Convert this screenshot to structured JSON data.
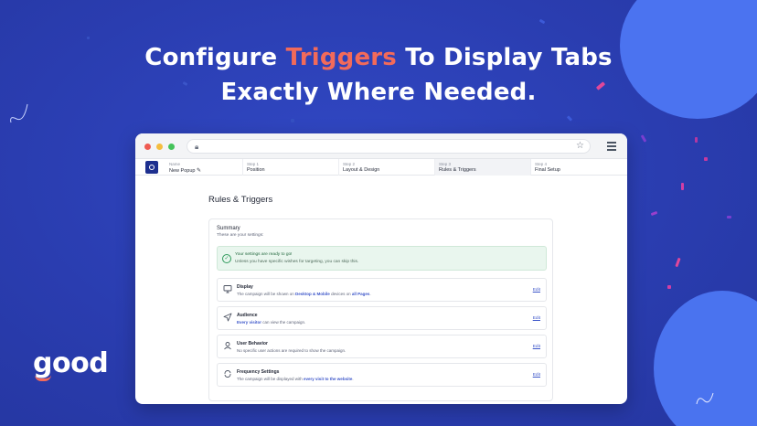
{
  "headline": {
    "line1_pre": "Configure ",
    "line1_accent": "Triggers",
    "line1_post": " To Display Tabs",
    "line2": "Exactly Where Needed."
  },
  "brand": "good",
  "colors": {
    "background": "#2a3fb0",
    "accent": "#f26a5a",
    "link": "#3b55c9",
    "success": "#2f9a5b"
  },
  "browser": {
    "lock_icon": "lock-icon",
    "star_icon": "star-icon",
    "menu_icon": "hamburger-icon"
  },
  "steps": [
    {
      "caption": "Name",
      "title": "New Popup"
    },
    {
      "caption": "Step 1",
      "title": "Position"
    },
    {
      "caption": "Step 2",
      "title": "Layout & Design"
    },
    {
      "caption": "Step 3",
      "title": "Rules & Triggers"
    },
    {
      "caption": "Step 4",
      "title": "Final Setup"
    }
  ],
  "page_title": "Rules & Triggers",
  "summary": {
    "title": "Summary",
    "subtitle": "These are your settings:",
    "ready_title": "Your settings are ready to go!",
    "ready_sub": "Unless you have specific wishes for targeting, you can skip this."
  },
  "rules": [
    {
      "title": "Display",
      "icon": "monitor-icon",
      "d1": "The campaign will be shown on ",
      "h1": "Desktop & Mobile",
      "d2": " devices on ",
      "h2": "all Pages",
      "d3": ".",
      "edit": "Edit"
    },
    {
      "title": "Audience",
      "icon": "send-icon",
      "d1": "",
      "h1": "Every visitor",
      "d2": " can view the campaign.",
      "h2": "",
      "d3": "",
      "edit": "Edit"
    },
    {
      "title": "User Behavior",
      "icon": "user-icon",
      "d1": "No specific user actions are required to show the campaign.",
      "h1": "",
      "d2": "",
      "h2": "",
      "d3": "",
      "edit": "Edit"
    },
    {
      "title": "Frequency Settings",
      "icon": "repeat-icon",
      "d1": "The campaign will be displayed with ",
      "h1": "every visit to the website",
      "d2": ".",
      "h2": "",
      "d3": "",
      "edit": "Edit"
    }
  ]
}
